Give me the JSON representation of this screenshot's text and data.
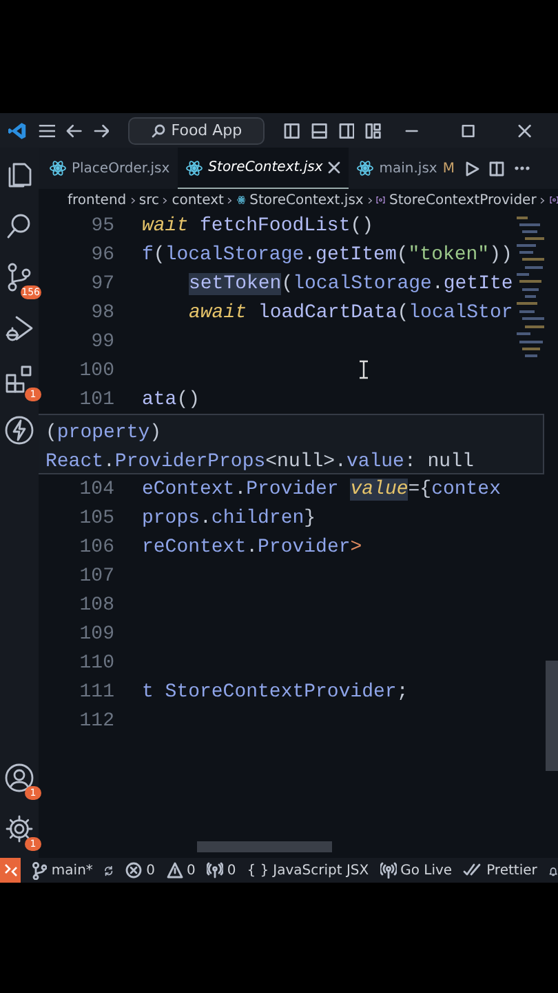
{
  "title_bar": {
    "search": "Food App"
  },
  "activity_bar": {
    "top": [
      {
        "kind": "explorer"
      },
      {
        "kind": "search"
      },
      {
        "kind": "source-control",
        "badge": "156"
      },
      {
        "kind": "run-debug"
      },
      {
        "kind": "extensions",
        "badge": "1"
      },
      {
        "kind": "lightning"
      }
    ],
    "bottom": [
      {
        "kind": "accounts",
        "badge": "1"
      },
      {
        "kind": "settings",
        "badge": "1"
      }
    ]
  },
  "tabs": [
    {
      "label": "PlaceOrder.jsx",
      "selected": false
    },
    {
      "label": "StoreContext.jsx",
      "selected": true
    },
    {
      "label": "main.jsx",
      "selected": false,
      "status": "M"
    }
  ],
  "breadcrumb": [
    {
      "label": "frontend",
      "kind": "folder"
    },
    {
      "label": "src",
      "kind": "folder"
    },
    {
      "label": "context",
      "kind": "folder"
    },
    {
      "label": "StoreContext.jsx",
      "kind": "file"
    },
    {
      "label": "StoreContextProvider",
      "kind": "symbol"
    }
  ],
  "editor": {
    "lines_above": [
      {
        "number": "95",
        "indented": false,
        "tokens": [
          {
            "text": "wait",
            "kind": "keyword"
          },
          {
            "text": " fetchFoodList",
            "kind": "function"
          },
          {
            "text": "()",
            "kind": "punct"
          }
        ]
      },
      {
        "number": "96",
        "indented": false,
        "tokens": [
          {
            "text": "f",
            "kind": "variable"
          },
          {
            "text": "(",
            "kind": "punct"
          },
          {
            "text": "localStorage",
            "kind": "variable"
          },
          {
            "text": ".",
            "kind": "punct"
          },
          {
            "text": "getItem",
            "kind": "function"
          },
          {
            "text": "(",
            "kind": "punct"
          },
          {
            "text": "\"token\"",
            "kind": "string"
          },
          {
            "text": "))",
            "kind": "punct"
          }
        ]
      },
      {
        "number": "97",
        "indented": true,
        "tokens": [
          {
            "text": "setToken",
            "kind": "highlight"
          },
          {
            "text": "(",
            "kind": "punct"
          },
          {
            "text": "localStorage",
            "kind": "variable"
          },
          {
            "text": ".",
            "kind": "punct"
          },
          {
            "text": "getIte",
            "kind": "function"
          }
        ]
      },
      {
        "number": "98",
        "indented": true,
        "tokens": [
          {
            "text": "await",
            "kind": "keyword"
          },
          {
            "text": " loadCartData",
            "kind": "function"
          },
          {
            "text": "(",
            "kind": "punct"
          },
          {
            "text": "localStor",
            "kind": "variable"
          }
        ]
      },
      {
        "number": "99"
      },
      {
        "number": "100"
      },
      {
        "number": "101",
        "indented": false,
        "tokens": [
          {
            "text": "ata",
            "kind": "function"
          },
          {
            "text": "()",
            "kind": "punct"
          }
        ]
      }
    ],
    "lines_below": [
      {
        "number": "104",
        "indented": false,
        "tokens": [
          {
            "text": "eContext",
            "kind": "variable"
          },
          {
            "text": ".",
            "kind": "punct"
          },
          {
            "text": "Provider ",
            "kind": "variable"
          },
          {
            "text": "value",
            "kind": "attr-highlight"
          },
          {
            "text": "={",
            "kind": "punct"
          },
          {
            "text": "contex",
            "kind": "variable"
          }
        ]
      },
      {
        "number": "105",
        "indented": false,
        "tokens": [
          {
            "text": "props",
            "kind": "variable"
          },
          {
            "text": ".",
            "kind": "punct"
          },
          {
            "text": "children",
            "kind": "variable"
          },
          {
            "text": "}",
            "kind": "punct"
          }
        ]
      },
      {
        "number": "106",
        "indented": false,
        "tokens": [
          {
            "text": "reContext",
            "kind": "variable"
          },
          {
            "text": ".",
            "kind": "punct"
          },
          {
            "text": "Provider",
            "kind": "variable"
          },
          {
            "text": ">",
            "kind": "tag"
          }
        ]
      },
      {
        "number": "107"
      },
      {
        "number": "108"
      },
      {
        "number": "109"
      },
      {
        "number": "110"
      },
      {
        "number": "111",
        "indented": false,
        "tokens": [
          {
            "text": "t StoreContextProvider",
            "kind": "variable"
          },
          {
            "text": ";",
            "kind": "punct"
          }
        ]
      },
      {
        "number": "112"
      }
    ]
  },
  "hover": {
    "lines": [
      [
        {
          "text": "(",
          "kind": "punct"
        },
        {
          "text": "property",
          "kind": "variable"
        },
        {
          "text": ")",
          "kind": "punct"
        }
      ],
      [
        {
          "text": "React",
          "kind": "variable"
        },
        {
          "text": ".",
          "kind": "punct"
        },
        {
          "text": "ProviderProps",
          "kind": "variable"
        },
        {
          "text": "<null>.",
          "kind": "punct"
        },
        {
          "text": "value",
          "kind": "variable"
        },
        {
          "text": ": null",
          "kind": "punct"
        }
      ]
    ]
  },
  "status_bar": [
    {
      "kind": "remote"
    },
    {
      "kind": "branch",
      "label": "main*"
    },
    {
      "kind": "sync"
    },
    {
      "kind": "errors",
      "label": "0"
    },
    {
      "kind": "warnings",
      "label": "0"
    },
    {
      "kind": "ports",
      "label": "0"
    },
    {
      "kind": "language",
      "icon": "{ }",
      "label": "JavaScript JSX"
    },
    {
      "kind": "go-live",
      "label": "Go Live"
    },
    {
      "kind": "prettier",
      "label": "Prettier"
    },
    {
      "kind": "bell"
    }
  ]
}
